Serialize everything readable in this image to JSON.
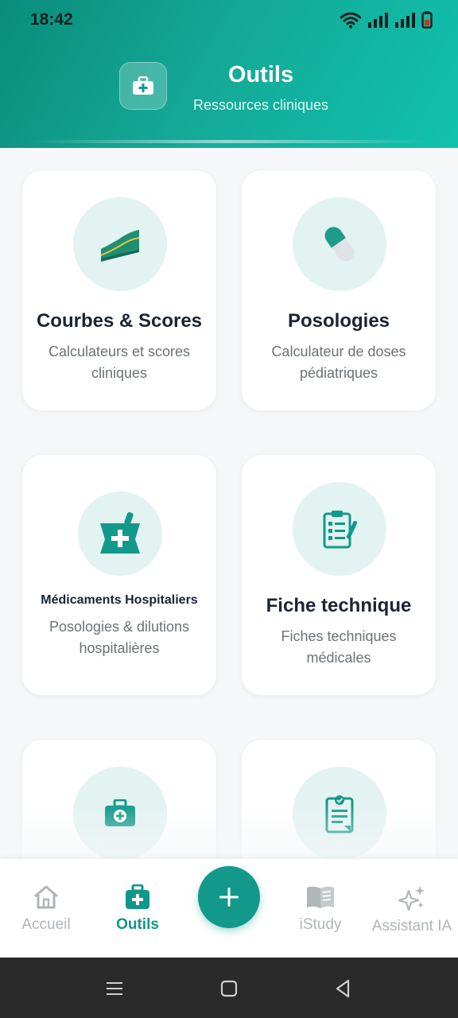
{
  "status_bar": {
    "time": "18:42"
  },
  "header": {
    "title": "Outils",
    "subtitle": "Ressources cliniques",
    "icon": "first-aid-kit-icon"
  },
  "cards": [
    {
      "title": "Courbes & Scores",
      "description": "Calculateurs et scores cliniques",
      "icon": "growth-chart-icon"
    },
    {
      "title": "Posologies",
      "description": "Calculateur de doses pédiatriques",
      "icon": "capsule-icon"
    },
    {
      "title": "Médicaments Hospitaliers",
      "description": "Posologies & dilutions hospitalières",
      "icon": "mortar-pestle-icon"
    },
    {
      "title": "Fiche technique",
      "description": "Fiches techniques médicales",
      "icon": "clipboard-checklist-icon"
    },
    {
      "title": "",
      "description": "",
      "icon": "medical-kit-icon"
    },
    {
      "title": "",
      "description": "",
      "icon": "medical-document-icon"
    }
  ],
  "bottom_nav": {
    "items": [
      {
        "label": "Accueil",
        "icon": "home-icon",
        "active": false
      },
      {
        "label": "Outils",
        "icon": "first-aid-kit-icon",
        "active": true
      },
      {
        "label": "iStudy",
        "icon": "book-icon",
        "active": false
      },
      {
        "label": "Assistant IA",
        "icon": "sparkles-icon",
        "active": false
      }
    ],
    "fab_icon": "plus-icon"
  },
  "colors": {
    "primary": "#12998b",
    "header_gradient_start": "#0b8c7b",
    "header_gradient_end": "#10c2ad",
    "icon_circle_bg": "#e3f3f1",
    "title_text": "#1b2433",
    "muted_text": "#6b7275"
  }
}
